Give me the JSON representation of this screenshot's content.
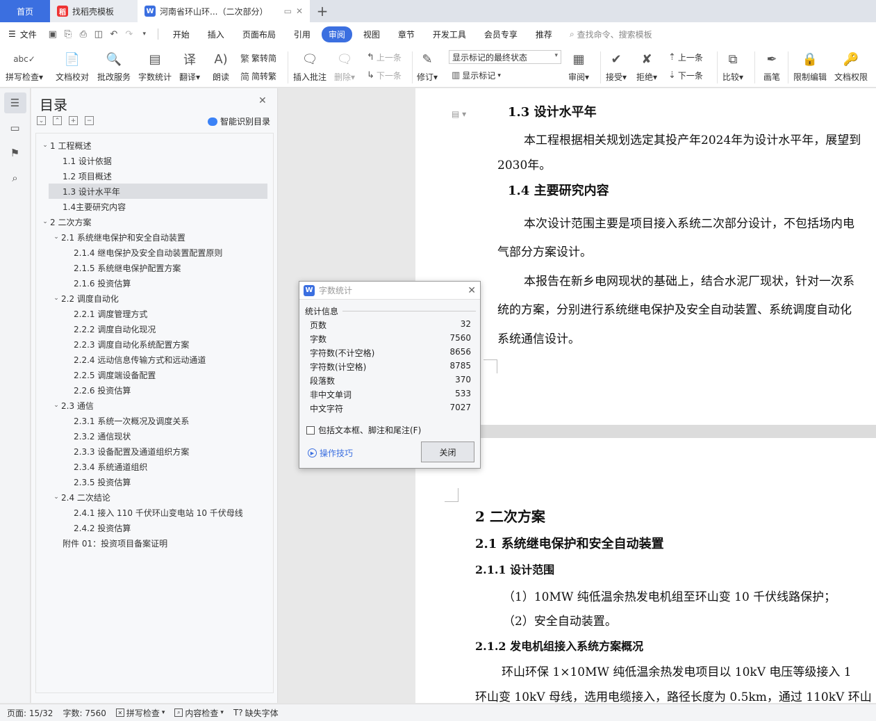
{
  "tabs": {
    "home": "首页",
    "t1": "找稻壳模板",
    "t2": "河南省环山环...（二次部分）",
    "add_icon": "plus-icon"
  },
  "menu": {
    "file": "文件",
    "items": [
      "开始",
      "插入",
      "页面布局",
      "引用",
      "审阅",
      "视图",
      "章节",
      "开发工具",
      "会员专享",
      "推荐"
    ],
    "active": "审阅",
    "search": "查找命令、搜索模板"
  },
  "ribbon": {
    "spellcheck": "拼写检查",
    "proofread": "文档校对",
    "review_service": "批改服务",
    "word_count": "字数统计",
    "translate": "翻译",
    "read_aloud": "朗读",
    "trad_to_simp": "繁转简",
    "simp_to_trad": "简转繁",
    "insert_comment": "插入批注",
    "delete": "删除",
    "prev_comment": "上一条",
    "next_comment": "下一条",
    "track": "修订",
    "markup_state": "显示标记的最终状态",
    "show_markup": "显示标记",
    "review": "审阅",
    "accept": "接受",
    "reject": "拒绝",
    "prev_change": "上一条",
    "next_change": "下一条",
    "compare": "比较",
    "ink": "画笔",
    "restrict_edit": "限制编辑",
    "doc_permission": "文档权限"
  },
  "toc": {
    "title": "目录",
    "smart": "智能识别目录",
    "items": [
      {
        "label": "1 工程概述",
        "level": 1,
        "expanded": true
      },
      {
        "label": "1.1 设计依据",
        "level": 2,
        "leaf": true
      },
      {
        "label": "1.2 项目概述",
        "level": 2,
        "leaf": true
      },
      {
        "label": "1.3  设计水平年",
        "level": 2,
        "leaf": true,
        "selected": true
      },
      {
        "label": "1.4主要研究内容",
        "level": 2,
        "leaf": true
      },
      {
        "label": "2  二次方案",
        "level": 1,
        "expanded": true
      },
      {
        "label": "2.1  系统继电保护和安全自动装置",
        "level": 2,
        "expanded": true
      },
      {
        "label": "2.1.4 继电保护及安全自动装置配置原则",
        "level": 3
      },
      {
        "label": "2.1.5 系统继电保护配置方案",
        "level": 3
      },
      {
        "label": "2.1.6 投资估算",
        "level": 3
      },
      {
        "label": "2.2 调度自动化",
        "level": 2,
        "expanded": true
      },
      {
        "label": "2.2.1 调度管理方式",
        "level": 3
      },
      {
        "label": "2.2.2 调度自动化现况",
        "level": 3
      },
      {
        "label": "2.2.3 调度自动化系统配置方案",
        "level": 3
      },
      {
        "label": "2.2.4 远动信息传输方式和远动通道",
        "level": 3
      },
      {
        "label": "2.2.5 调度端设备配置",
        "level": 3
      },
      {
        "label": "2.2.6 投资估算",
        "level": 3
      },
      {
        "label": "2.3  通信",
        "level": 2,
        "expanded": true
      },
      {
        "label": "2.3.1 系统一次概况及调度关系",
        "level": 3
      },
      {
        "label": "2.3.2 通信现状",
        "level": 3
      },
      {
        "label": "2.3.3 设备配置及通道组织方案",
        "level": 3
      },
      {
        "label": "2.3.4 系统通道组织",
        "level": 3
      },
      {
        "label": "2.3.5 投资估算",
        "level": 3
      },
      {
        "label": "2.4 二次结论",
        "level": 2,
        "expanded": true
      },
      {
        "label": "2.4.1 接入 110 千伏环山变电站 10 千伏母线",
        "level": 3
      },
      {
        "label": "2.4.2 投资估算",
        "level": 3
      },
      {
        "label": "附件 01：投资项目备案证明",
        "level": 2,
        "leaf": true
      }
    ]
  },
  "doc": {
    "p1": {
      "heading": "1.3   设计水平年",
      "line1": "本工程根据相关规划选定其投产年2024年为设计水平年，展望到",
      "line2": "2030年。",
      "heading2": "1.4 主要研究内容",
      "line3": "本次设计范围主要是项目接入系统二次部分设计，不包括场内电",
      "line4": "气部分方案设计。",
      "line5": "本报告在新乡电网现状的基础上，结合水泥厂现状，针对一次系",
      "line6": "统的方案，分别进行系统继电保护及安全自动装置、系统调度自动化",
      "line7": "系统通信设计。"
    },
    "p2": {
      "h1": "2  二次方案",
      "h2": "2.1  系统继电保护和安全自动装置",
      "h3a": "2.1.1 设计范围",
      "item1": "（1）10MW 纯低温余热发电机组至环山变 10 千伏线路保护；",
      "item2": "（2）安全自动装置。",
      "h3b": "2.1.2 发电机组接入系统方案概况",
      "line1": "环山环保 1×10MW 纯低温余热发电项目以 10kV 电压等级接入 1",
      "line2": "环山变 10kV 母线，选用电缆接入，路径长度为 0.5km，通过 110kV 环山"
    }
  },
  "dialog": {
    "title": "字数统计",
    "section": "统计信息",
    "rows": [
      {
        "label": "页数",
        "value": "32"
      },
      {
        "label": "字数",
        "value": "7560"
      },
      {
        "label": "字符数(不计空格)",
        "value": "8656"
      },
      {
        "label": "字符数(计空格)",
        "value": "8785"
      },
      {
        "label": "段落数",
        "value": "370"
      },
      {
        "label": "非中文单词",
        "value": "533"
      },
      {
        "label": "中文字符",
        "value": "7027"
      }
    ],
    "checkbox": "包括文本框、脚注和尾注(F)",
    "tips": "操作技巧",
    "close": "关闭"
  },
  "status": {
    "page": "页面: 15/32",
    "words": "字数: 7560",
    "spell": "拼写检查",
    "content": "内容检查",
    "missing_font": "缺失字体"
  }
}
